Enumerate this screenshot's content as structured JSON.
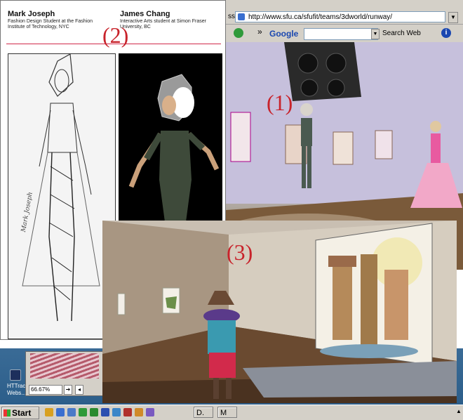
{
  "paper": {
    "designer_name": "Mark Joseph",
    "designer_desc": "Fashion Design Student at the Fashion Institute of Technology, NYC",
    "artist_name": "James Chang",
    "artist_desc": "Interactive Arts student at Simon Fraser University, BC",
    "signature": "Mark Joseph"
  },
  "browser": {
    "address": "http://www.sfu.ca/sfufit/teams/3dworld/runway/",
    "address_prefix": "ss",
    "google_label": "Google",
    "search_label": "Search Web",
    "title_fragment": "r"
  },
  "markers": {
    "one": "(1)",
    "two": "(2)",
    "three": "(3)"
  },
  "desktop": {
    "icon_label": "HTTrack Webs...",
    "zoom": "66.67%"
  },
  "taskbar": {
    "start_label": "Start",
    "task_d": "D.",
    "task_m": "M"
  },
  "colors": {
    "marker_red": "#c8232b",
    "rule_red": "#d12a4b",
    "taskbar": "#d4d0c8",
    "desktop": "#2c5e8a"
  }
}
